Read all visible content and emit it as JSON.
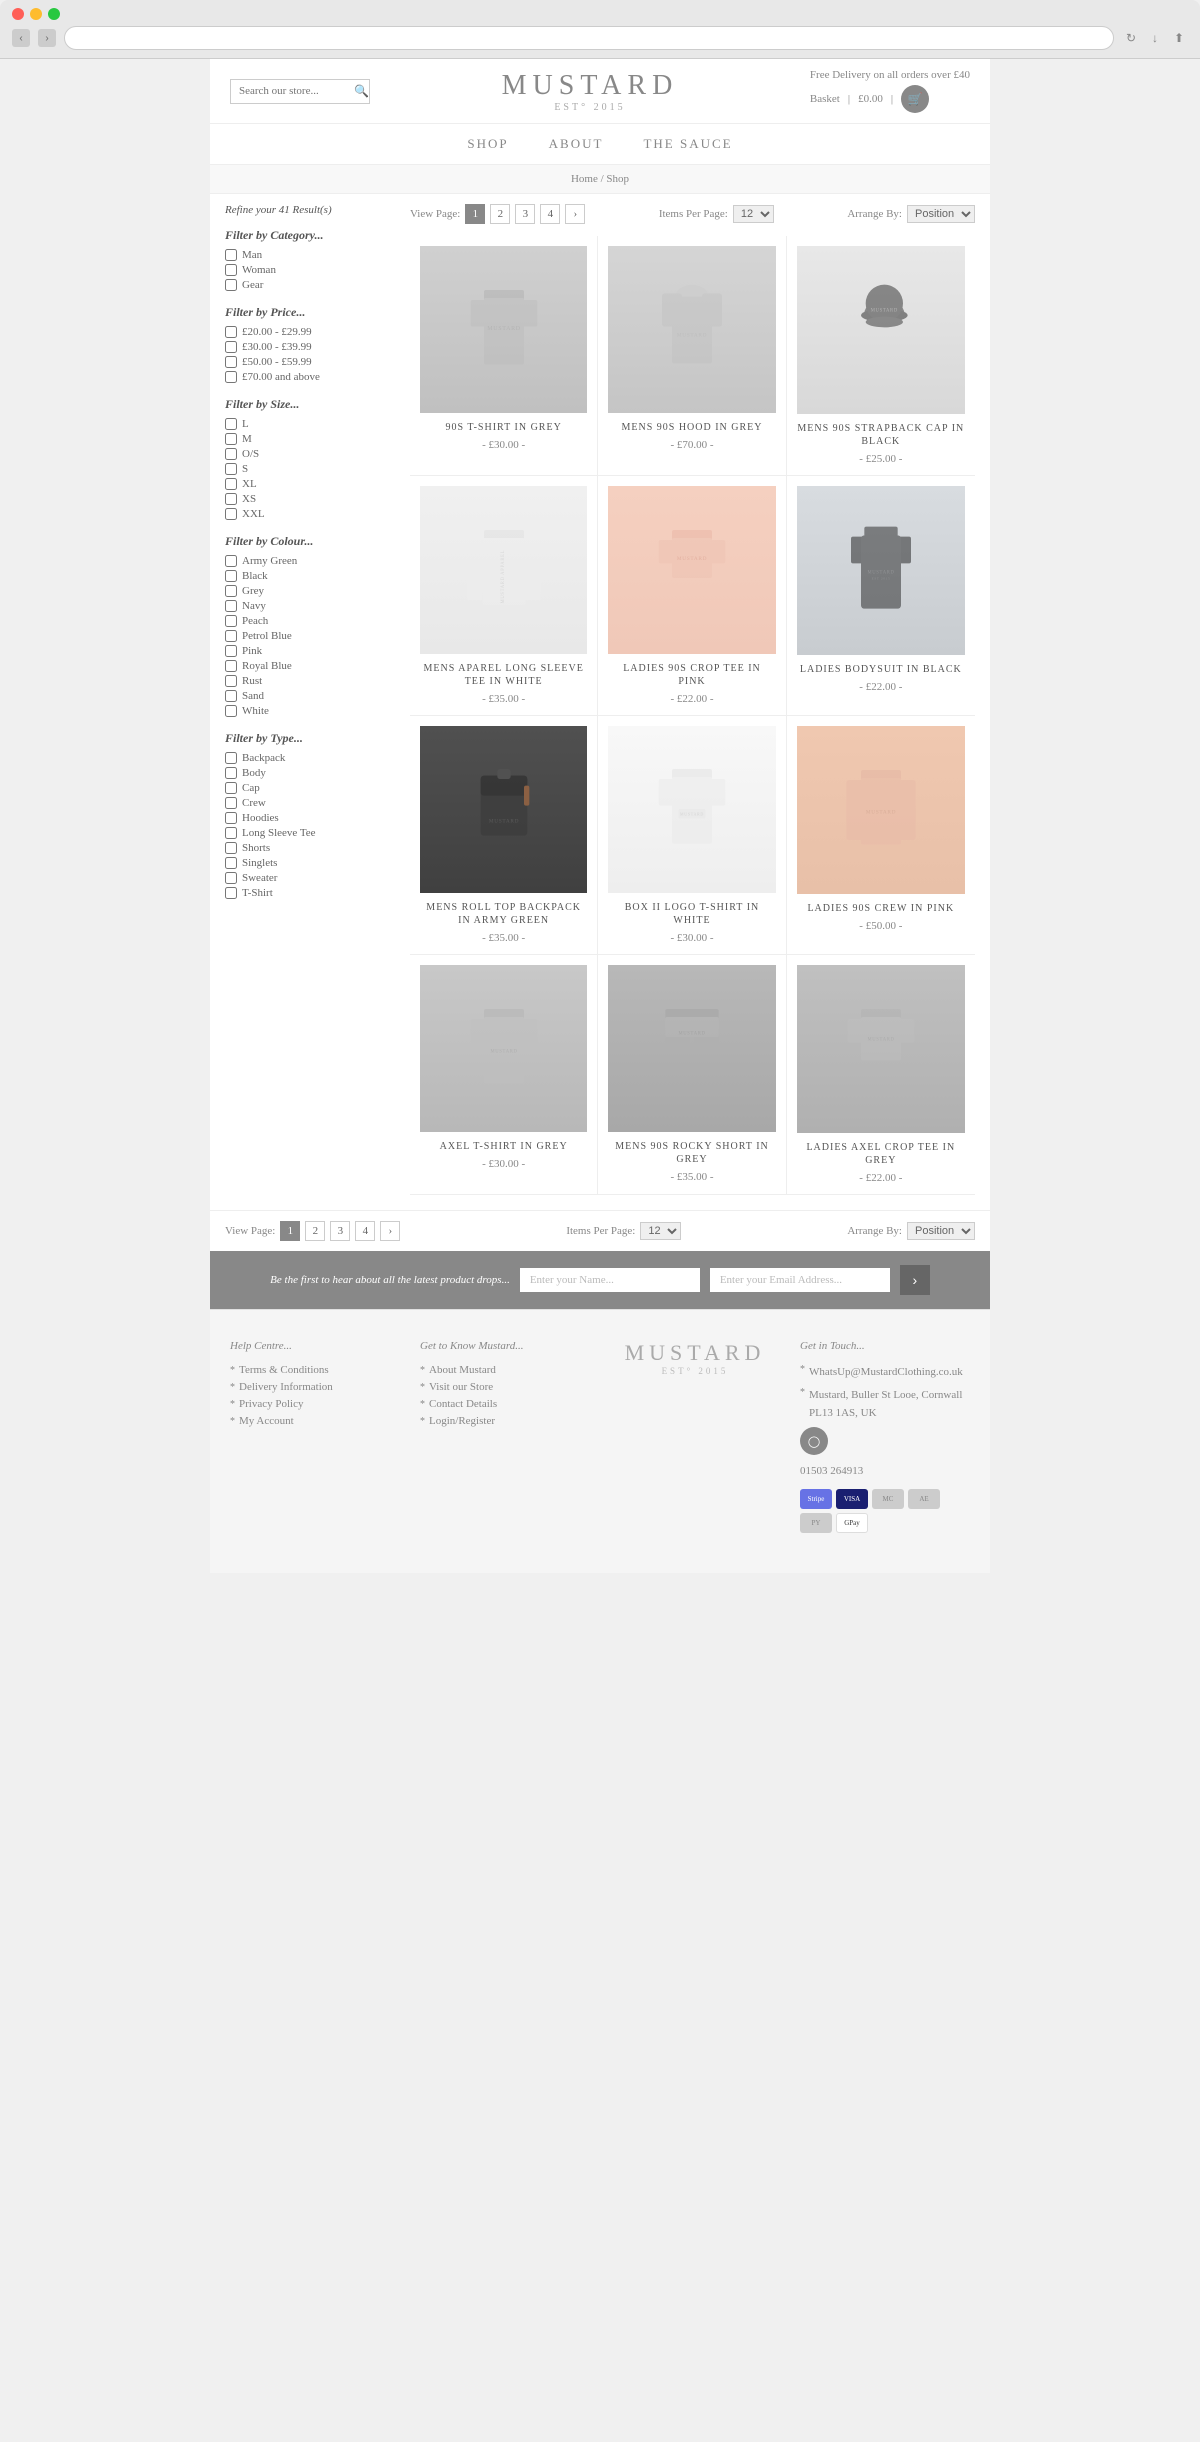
{
  "browser": {
    "url": ""
  },
  "header": {
    "search_placeholder": "Search our store...",
    "logo": "MUSTARD",
    "logo_est": "EST° 2015",
    "delivery_text": "Free Delivery on all orders over £40",
    "basket_label": "Basket",
    "basket_price": "£0.00"
  },
  "nav": {
    "items": [
      "SHOP",
      "ABOUT",
      "THE SAUCE"
    ]
  },
  "breadcrumb": {
    "home": "Home",
    "separator": "/",
    "current": "Shop"
  },
  "sidebar": {
    "refine_label": "Refine your 41 Result(s)",
    "filters": [
      {
        "title": "Filter by Category...",
        "options": [
          "Man",
          "Woman",
          "Gear"
        ]
      },
      {
        "title": "Filter by Price...",
        "options": [
          "£20.00 - £29.99",
          "£30.00 - £39.99",
          "£50.00 - £59.99",
          "£70.00 and above"
        ]
      },
      {
        "title": "Filter by Size...",
        "options": [
          "L",
          "M",
          "O/S",
          "S",
          "XL",
          "XS",
          "XXL"
        ]
      },
      {
        "title": "Filter by Colour...",
        "options": [
          "Army Green",
          "Black",
          "Grey",
          "Navy",
          "Peach",
          "Petrol Blue",
          "Pink",
          "Royal Blue",
          "Rust",
          "Sand",
          "White"
        ]
      },
      {
        "title": "Filter by Type...",
        "options": [
          "Backpack",
          "Body",
          "Cap",
          "Crew",
          "Hoodies",
          "Long Sleeve Tee",
          "Shorts",
          "Singlets",
          "Sweater",
          "T-Shirt"
        ]
      }
    ]
  },
  "pagination": {
    "view_page_label": "View Page:",
    "pages": [
      "1",
      "2",
      "3",
      "4",
      "›"
    ],
    "active_page": "1",
    "items_per_page_label": "Items Per Page:",
    "items_per_page_value": "12",
    "arrange_by_label": "Arrange By:",
    "arrange_by_value": "Position"
  },
  "products": [
    {
      "name": "90S T-SHIRT IN GREY",
      "price": "- £30.00 -",
      "img_class": "img-grey-tshirt"
    },
    {
      "name": "MENS 90S HOOD IN GREY",
      "price": "- £70.00 -",
      "img_class": "img-grey-hood"
    },
    {
      "name": "MENS 90S STRAPBACK CAP IN BLACK",
      "price": "- £25.00 -",
      "img_class": "img-cap-black"
    },
    {
      "name": "MENS APAREL LONG SLEEVE TEE IN WHITE",
      "price": "- £35.00 -",
      "img_class": "img-white-sleeve"
    },
    {
      "name": "LADIES 90S CROP TEE IN PINK",
      "price": "- £22.00 -",
      "img_class": "img-pink-crop"
    },
    {
      "name": "LADIES BODYSUIT IN BLACK",
      "price": "- £22.00 -",
      "img_class": "img-black-bodysuit"
    },
    {
      "name": "MENS ROLL TOP BACKPACK IN ARMY GREEN",
      "price": "- £35.00 -",
      "img_class": "img-backpack"
    },
    {
      "name": "BOX II LOGO T-SHIRT IN WHITE",
      "price": "- £30.00 -",
      "img_class": "img-white-tshirt"
    },
    {
      "name": "LADIES 90S CREW IN PINK",
      "price": "- £50.00 -",
      "img_class": "img-pink-crew"
    },
    {
      "name": "AXEL T-SHIRT IN GREY",
      "price": "- £30.00 -",
      "img_class": "img-grey-axel"
    },
    {
      "name": "MENS 90S ROCKY SHORT IN GREY",
      "price": "- £35.00 -",
      "img_class": "img-grey-shorts"
    },
    {
      "name": "LADIES AXEL CROP TEE IN GREY",
      "price": "- £22.00 -",
      "img_class": "img-grey-crop"
    }
  ],
  "newsletter": {
    "text": "Be the first to hear about all the latest product drops...",
    "name_placeholder": "Enter your Name...",
    "email_placeholder": "Enter your Email Address..."
  },
  "footer": {
    "logo": "MUSTARD",
    "logo_est": "EST° 2015",
    "help_title": "Help Centre...",
    "help_links": [
      "Terms & Conditions",
      "Delivery Information",
      "Privacy Policy",
      "My Account"
    ],
    "know_title": "Get to Know Mustard...",
    "know_links": [
      "About Mustard",
      "Visit our Store",
      "Contact Details",
      "Login/Register"
    ],
    "contact_title": "Get in Touch...",
    "contact_email": "WhatsUp@MustardClothing.co.uk",
    "contact_address": "Mustard, Buller St Looe, Cornwall PL13 1AS, UK",
    "contact_phone": "01503 264913",
    "payment_methods": [
      "Stripe",
      "VISA",
      "MC",
      "AE",
      "PY",
      "GPay"
    ]
  }
}
